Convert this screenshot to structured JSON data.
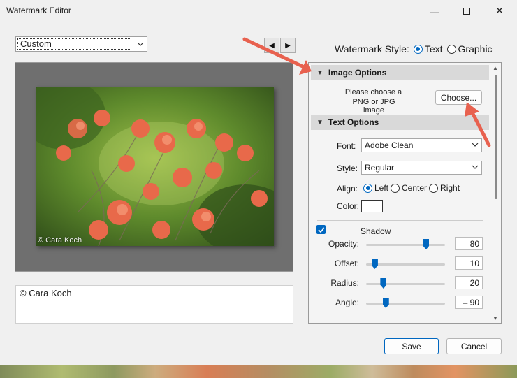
{
  "window": {
    "title": "Watermark Editor"
  },
  "preset": {
    "value": "Custom"
  },
  "nav": {
    "prev_glyph": "◀",
    "next_glyph": "▶"
  },
  "watermark_style": {
    "label": "Watermark Style:",
    "options": [
      {
        "label": "Text",
        "selected": true
      },
      {
        "label": "Graphic",
        "selected": false
      }
    ]
  },
  "preview": {
    "watermark_text": "© Cara Koch"
  },
  "text_input": {
    "value": "© Cara Koch"
  },
  "image_options": {
    "header": "Image Options",
    "prompt_line1": "Please choose a",
    "prompt_line2": "PNG or JPG image",
    "choose_label": "Choose..."
  },
  "text_options": {
    "header": "Text Options",
    "font_label": "Font:",
    "font_value": "Adobe Clean",
    "style_label": "Style:",
    "style_value": "Regular",
    "align_label": "Align:",
    "align_options": [
      {
        "label": "Left",
        "selected": true
      },
      {
        "label": "Center",
        "selected": false
      },
      {
        "label": "Right",
        "selected": false
      }
    ],
    "color_label": "Color:",
    "color_value": "#ffffff"
  },
  "shadow": {
    "label": "Shadow",
    "checked": true,
    "sliders": [
      {
        "label": "Opacity:",
        "value": "80",
        "fraction": 0.76
      },
      {
        "label": "Offset:",
        "value": "10",
        "fraction": 0.11
      },
      {
        "label": "Radius:",
        "value": "20",
        "fraction": 0.22
      },
      {
        "label": "Angle:",
        "value": "– 90",
        "fraction": 0.25
      }
    ]
  },
  "footer": {
    "save_label": "Save",
    "cancel_label": "Cancel"
  },
  "colors": {
    "accent": "#0067c0",
    "arrow": "#e8614f"
  },
  "icons": [
    "minimize-icon",
    "maximize-icon",
    "close-icon",
    "chevron-down-icon",
    "triangle-down-icon",
    "checkmark-icon"
  ]
}
